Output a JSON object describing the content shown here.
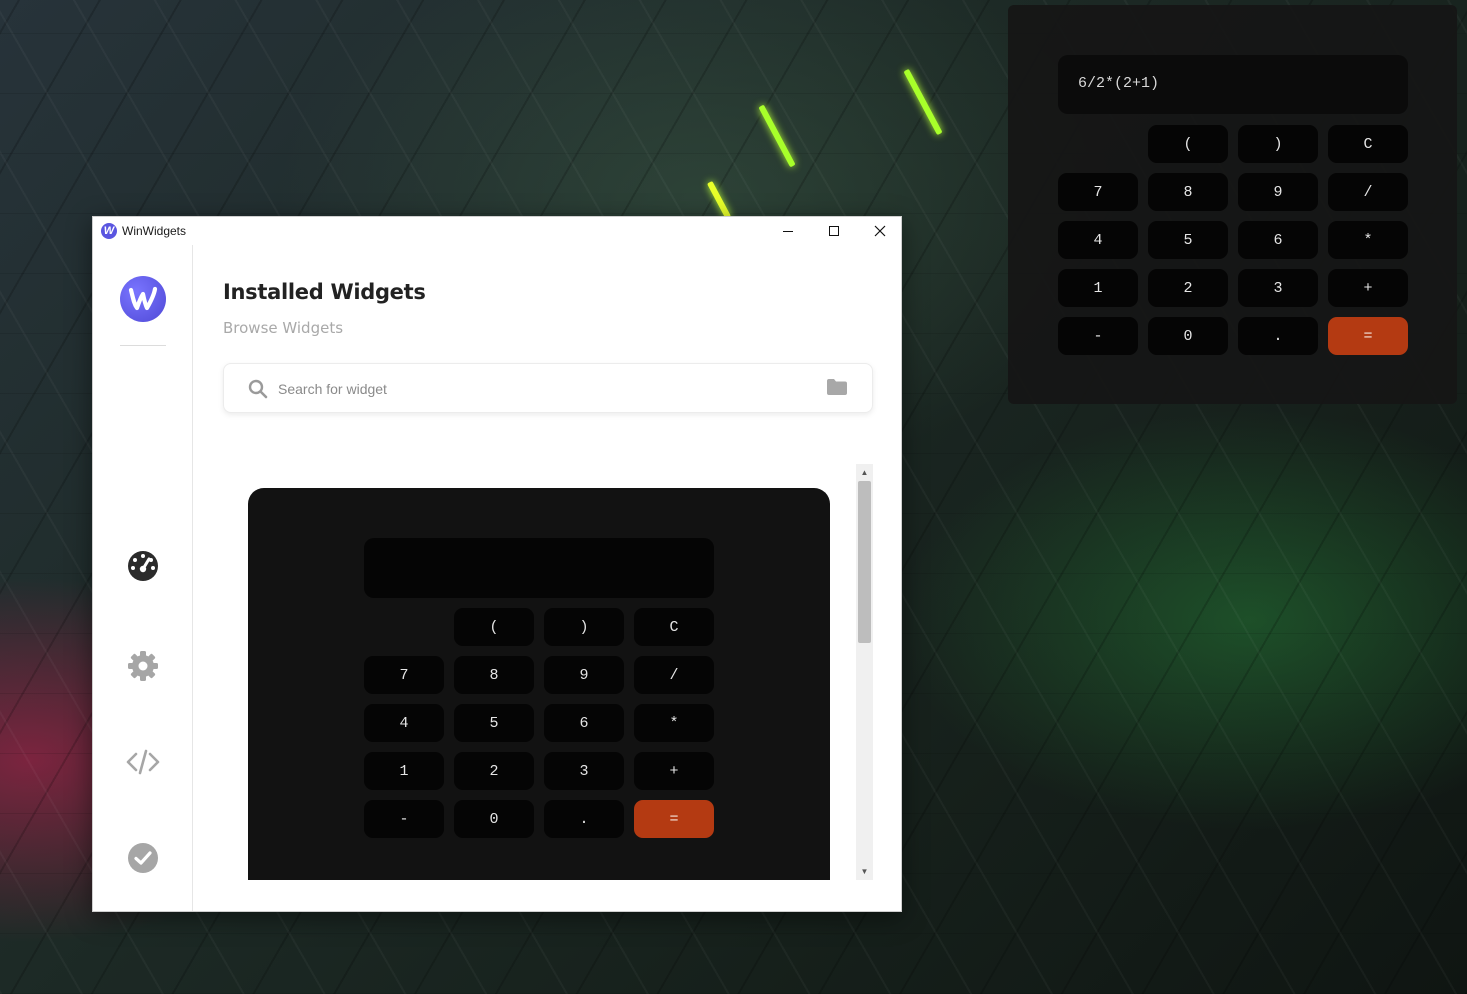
{
  "desktop_widget": {
    "display": "6/2*(2+1)",
    "keys": [
      {
        "label": ""
      },
      {
        "label": "("
      },
      {
        "label": ")"
      },
      {
        "label": "C"
      },
      {
        "label": "7"
      },
      {
        "label": "8"
      },
      {
        "label": "9"
      },
      {
        "label": "/"
      },
      {
        "label": "4"
      },
      {
        "label": "5"
      },
      {
        "label": "6"
      },
      {
        "label": "*"
      },
      {
        "label": "1"
      },
      {
        "label": "2"
      },
      {
        "label": "3"
      },
      {
        "label": "+"
      },
      {
        "label": "-"
      },
      {
        "label": "0"
      },
      {
        "label": "."
      },
      {
        "label": "="
      }
    ]
  },
  "window": {
    "title": "WinWidgets",
    "logo_glyph": "W",
    "page_title": "Installed Widgets",
    "subtitle": "Browse Widgets",
    "search": {
      "placeholder": "Search for widget",
      "value": ""
    },
    "nav_icons": [
      "dashboard-icon",
      "gear-icon",
      "code-icon",
      "check-circle-icon"
    ]
  },
  "preview_widget": {
    "display": "",
    "keys": [
      {
        "label": ""
      },
      {
        "label": "("
      },
      {
        "label": ")"
      },
      {
        "label": "C"
      },
      {
        "label": "7"
      },
      {
        "label": "8"
      },
      {
        "label": "9"
      },
      {
        "label": "/"
      },
      {
        "label": "4"
      },
      {
        "label": "5"
      },
      {
        "label": "6"
      },
      {
        "label": "*"
      },
      {
        "label": "1"
      },
      {
        "label": "2"
      },
      {
        "label": "3"
      },
      {
        "label": "+"
      },
      {
        "label": "-"
      },
      {
        "label": "0"
      },
      {
        "label": "."
      },
      {
        "label": "="
      }
    ]
  },
  "colors": {
    "equals_key": "#b43a12",
    "logo": "#5a55e0",
    "calc_background": "#121212"
  }
}
